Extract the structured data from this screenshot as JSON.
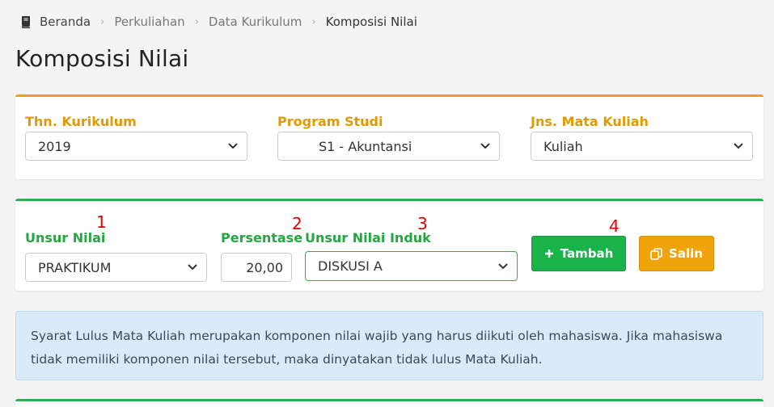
{
  "breadcrumb": {
    "items": [
      "Beranda",
      "Perkuliahan",
      "Data Kurikulum",
      "Komposisi Nilai"
    ]
  },
  "page": {
    "title": "Komposisi Nilai"
  },
  "filter": {
    "kurikulum": {
      "label": "Thn. Kurikulum",
      "value": "2019"
    },
    "prodi": {
      "label": "Program Studi",
      "value": "S1 - Akuntansi"
    },
    "jenis": {
      "label": "Jns. Mata Kuliah",
      "value": "Kuliah"
    }
  },
  "form": {
    "unsur": {
      "label": "Unsur Nilai",
      "value": "PRAKTIKUM"
    },
    "persentase": {
      "label": "Persentase",
      "value": "20,00"
    },
    "induk": {
      "label": "Unsur Nilai Induk",
      "value": "DISKUSI A"
    },
    "tambah_label": "Tambah",
    "salin_label": "Salin",
    "markers": [
      "1",
      "2",
      "3",
      "4"
    ]
  },
  "alert": {
    "text": "Syarat Lulus Mata Kuliah merupakan komponen nilai wajib yang harus diikuti oleh mahasiswa. Jika mahasiswa tidak memiliki komponen nilai tersebut, maka dinyatakan tidak lulus Mata Kuliah."
  },
  "colors": {
    "accent_orange": "#e8a21a",
    "accent_green": "#2db14c",
    "alert_bg": "#d9ebf9",
    "marker_red": "#e00000"
  },
  "icons": {
    "breadcrumb": "book-icon",
    "select": "chevron-down-icon",
    "tambah": "plus-icon",
    "salin": "copy-icon"
  }
}
